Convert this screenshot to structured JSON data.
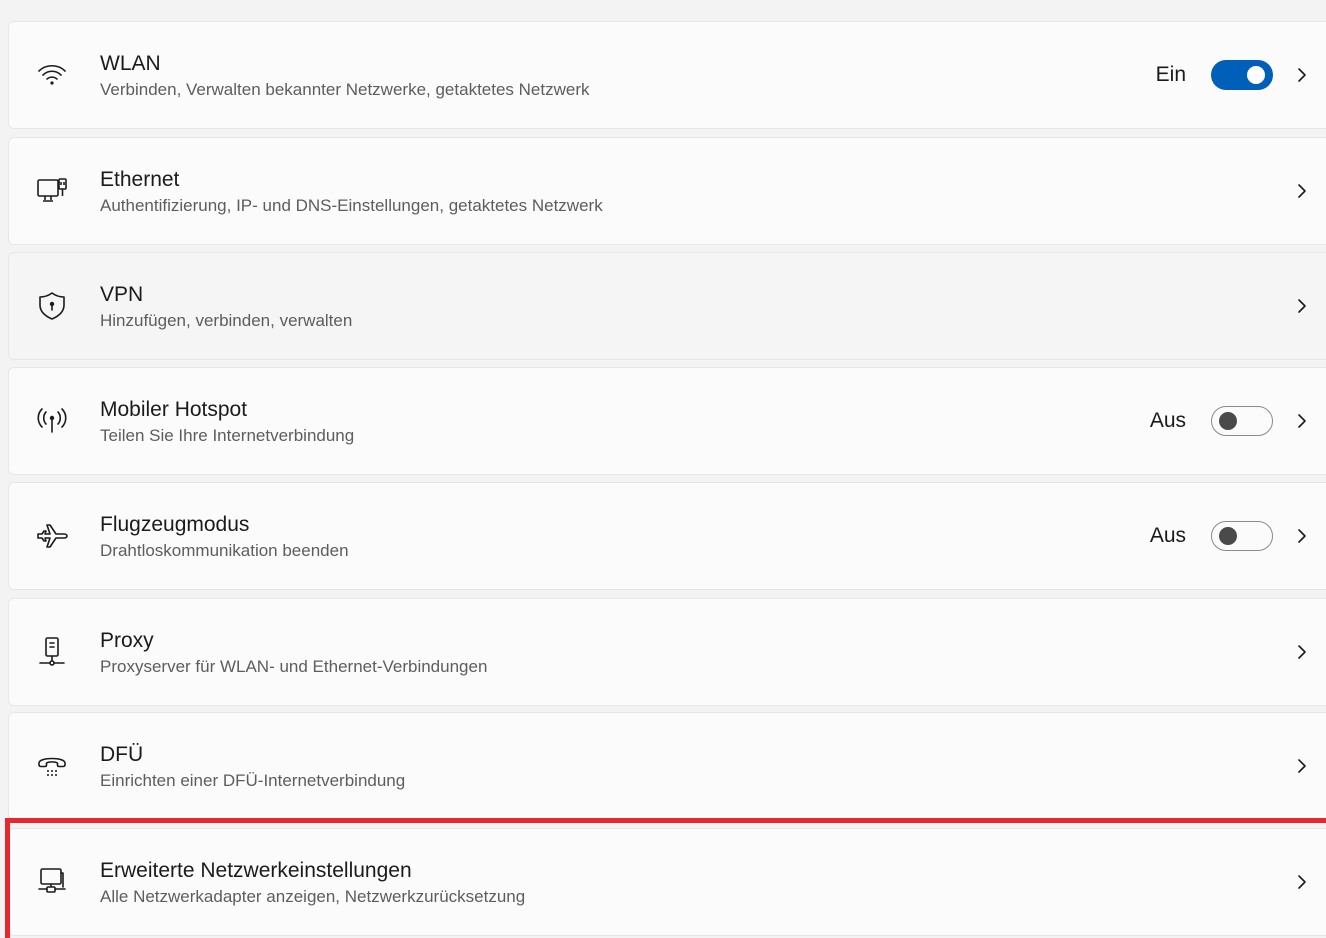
{
  "items": [
    {
      "title": "WLAN",
      "subtitle": "Verbinden, Verwalten bekannter Netzwerke, getaktetes Netzwerk",
      "icon": "wifi-icon",
      "state": "Ein",
      "toggle": "on"
    },
    {
      "title": "Ethernet",
      "subtitle": "Authentifizierung, IP- und DNS-Einstellungen, getaktetes Netzwerk",
      "icon": "ethernet-icon"
    },
    {
      "title": "VPN",
      "subtitle": "Hinzufügen, verbinden, verwalten",
      "icon": "vpn-shield-icon"
    },
    {
      "title": "Mobiler Hotspot",
      "subtitle": "Teilen Sie Ihre Internetverbindung",
      "icon": "hotspot-icon",
      "state": "Aus",
      "toggle": "off"
    },
    {
      "title": "Flugzeugmodus",
      "subtitle": "Drahtloskommunikation beenden",
      "icon": "airplane-icon",
      "state": "Aus",
      "toggle": "off"
    },
    {
      "title": "Proxy",
      "subtitle": "Proxyserver für WLAN- und Ethernet-Verbindungen",
      "icon": "proxy-icon"
    },
    {
      "title": "DFÜ",
      "subtitle": "Einrichten einer DFÜ-Internetverbindung",
      "icon": "dialup-phone-icon"
    },
    {
      "title": "Erweiterte Netzwerkeinstellungen",
      "subtitle": "Alle Netzwerkadapter anzeigen, Netzwerkzurücksetzung",
      "icon": "network-pc-icon"
    }
  ],
  "colors": {
    "accent": "#005fb8",
    "highlight": "#e8272c"
  }
}
